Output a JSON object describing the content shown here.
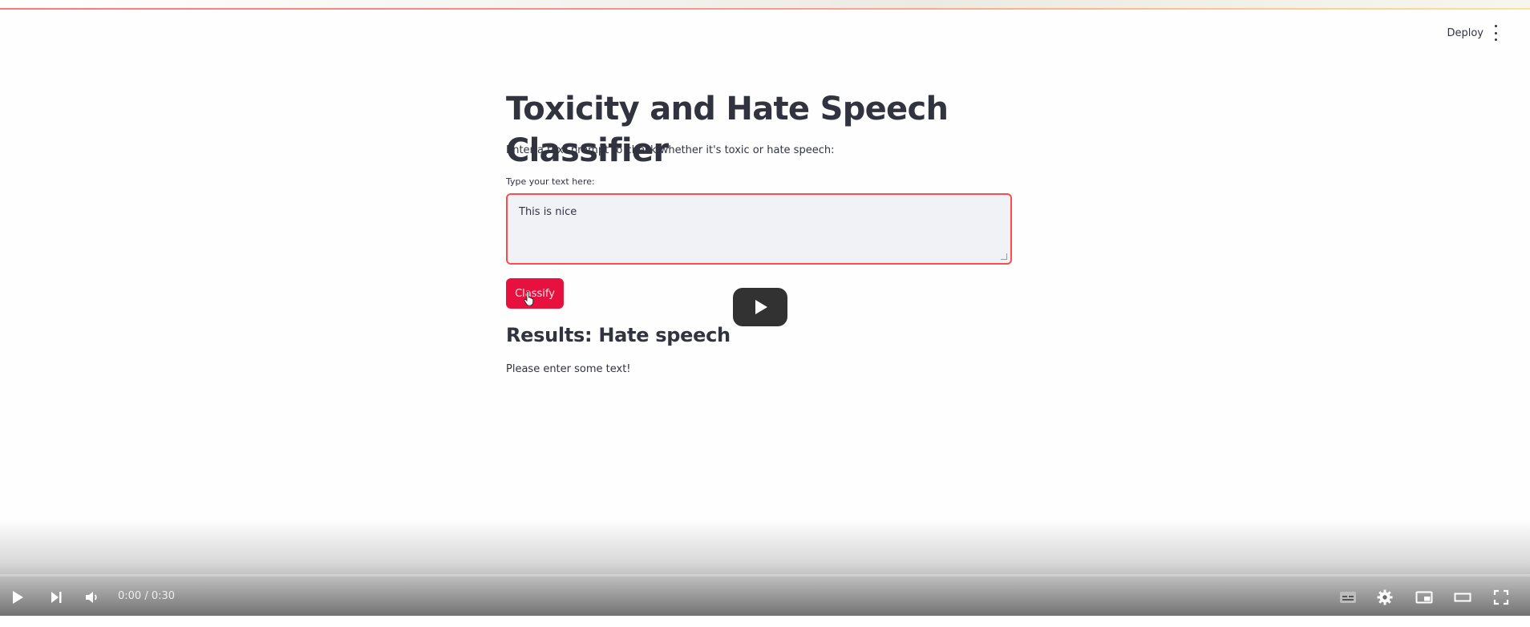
{
  "header": {
    "deploy_label": "Deploy"
  },
  "app": {
    "title": "Toxicity and Hate Speech Classifier",
    "subtitle": "Enter a text prompt to check whether it's toxic or hate speech:",
    "input_label": "Type your text here:",
    "input_value": "This is nice",
    "button_label": "Classify",
    "results_heading": "Results: Hate speech",
    "message": "Please enter some text!"
  },
  "player": {
    "time_display": "0:00 / 0:30",
    "progress_fraction": 0.0,
    "icons": [
      "play-icon",
      "next-icon",
      "volume-icon",
      "subtitles-icon",
      "settings-icon",
      "miniplayer-icon",
      "theater-icon",
      "fullscreen-icon"
    ]
  },
  "colors": {
    "accent": "#ff4b4b",
    "button": "#e8103e",
    "text": "#31333f",
    "input_bg": "#f0f2f6"
  }
}
